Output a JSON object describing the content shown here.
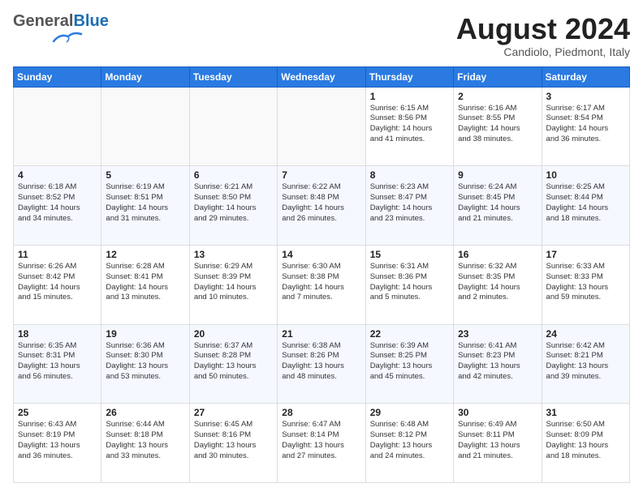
{
  "header": {
    "logo_general": "General",
    "logo_blue": "Blue",
    "month_title": "August 2024",
    "subtitle": "Candiolo, Piedmont, Italy"
  },
  "days_of_week": [
    "Sunday",
    "Monday",
    "Tuesday",
    "Wednesday",
    "Thursday",
    "Friday",
    "Saturday"
  ],
  "weeks": [
    [
      {
        "day": "",
        "info": ""
      },
      {
        "day": "",
        "info": ""
      },
      {
        "day": "",
        "info": ""
      },
      {
        "day": "",
        "info": ""
      },
      {
        "day": "1",
        "info": "Sunrise: 6:15 AM\nSunset: 8:56 PM\nDaylight: 14 hours\nand 41 minutes."
      },
      {
        "day": "2",
        "info": "Sunrise: 6:16 AM\nSunset: 8:55 PM\nDaylight: 14 hours\nand 38 minutes."
      },
      {
        "day": "3",
        "info": "Sunrise: 6:17 AM\nSunset: 8:54 PM\nDaylight: 14 hours\nand 36 minutes."
      }
    ],
    [
      {
        "day": "4",
        "info": "Sunrise: 6:18 AM\nSunset: 8:52 PM\nDaylight: 14 hours\nand 34 minutes."
      },
      {
        "day": "5",
        "info": "Sunrise: 6:19 AM\nSunset: 8:51 PM\nDaylight: 14 hours\nand 31 minutes."
      },
      {
        "day": "6",
        "info": "Sunrise: 6:21 AM\nSunset: 8:50 PM\nDaylight: 14 hours\nand 29 minutes."
      },
      {
        "day": "7",
        "info": "Sunrise: 6:22 AM\nSunset: 8:48 PM\nDaylight: 14 hours\nand 26 minutes."
      },
      {
        "day": "8",
        "info": "Sunrise: 6:23 AM\nSunset: 8:47 PM\nDaylight: 14 hours\nand 23 minutes."
      },
      {
        "day": "9",
        "info": "Sunrise: 6:24 AM\nSunset: 8:45 PM\nDaylight: 14 hours\nand 21 minutes."
      },
      {
        "day": "10",
        "info": "Sunrise: 6:25 AM\nSunset: 8:44 PM\nDaylight: 14 hours\nand 18 minutes."
      }
    ],
    [
      {
        "day": "11",
        "info": "Sunrise: 6:26 AM\nSunset: 8:42 PM\nDaylight: 14 hours\nand 15 minutes."
      },
      {
        "day": "12",
        "info": "Sunrise: 6:28 AM\nSunset: 8:41 PM\nDaylight: 14 hours\nand 13 minutes."
      },
      {
        "day": "13",
        "info": "Sunrise: 6:29 AM\nSunset: 8:39 PM\nDaylight: 14 hours\nand 10 minutes."
      },
      {
        "day": "14",
        "info": "Sunrise: 6:30 AM\nSunset: 8:38 PM\nDaylight: 14 hours\nand 7 minutes."
      },
      {
        "day": "15",
        "info": "Sunrise: 6:31 AM\nSunset: 8:36 PM\nDaylight: 14 hours\nand 5 minutes."
      },
      {
        "day": "16",
        "info": "Sunrise: 6:32 AM\nSunset: 8:35 PM\nDaylight: 14 hours\nand 2 minutes."
      },
      {
        "day": "17",
        "info": "Sunrise: 6:33 AM\nSunset: 8:33 PM\nDaylight: 13 hours\nand 59 minutes."
      }
    ],
    [
      {
        "day": "18",
        "info": "Sunrise: 6:35 AM\nSunset: 8:31 PM\nDaylight: 13 hours\nand 56 minutes."
      },
      {
        "day": "19",
        "info": "Sunrise: 6:36 AM\nSunset: 8:30 PM\nDaylight: 13 hours\nand 53 minutes."
      },
      {
        "day": "20",
        "info": "Sunrise: 6:37 AM\nSunset: 8:28 PM\nDaylight: 13 hours\nand 50 minutes."
      },
      {
        "day": "21",
        "info": "Sunrise: 6:38 AM\nSunset: 8:26 PM\nDaylight: 13 hours\nand 48 minutes."
      },
      {
        "day": "22",
        "info": "Sunrise: 6:39 AM\nSunset: 8:25 PM\nDaylight: 13 hours\nand 45 minutes."
      },
      {
        "day": "23",
        "info": "Sunrise: 6:41 AM\nSunset: 8:23 PM\nDaylight: 13 hours\nand 42 minutes."
      },
      {
        "day": "24",
        "info": "Sunrise: 6:42 AM\nSunset: 8:21 PM\nDaylight: 13 hours\nand 39 minutes."
      }
    ],
    [
      {
        "day": "25",
        "info": "Sunrise: 6:43 AM\nSunset: 8:19 PM\nDaylight: 13 hours\nand 36 minutes."
      },
      {
        "day": "26",
        "info": "Sunrise: 6:44 AM\nSunset: 8:18 PM\nDaylight: 13 hours\nand 33 minutes."
      },
      {
        "day": "27",
        "info": "Sunrise: 6:45 AM\nSunset: 8:16 PM\nDaylight: 13 hours\nand 30 minutes."
      },
      {
        "day": "28",
        "info": "Sunrise: 6:47 AM\nSunset: 8:14 PM\nDaylight: 13 hours\nand 27 minutes."
      },
      {
        "day": "29",
        "info": "Sunrise: 6:48 AM\nSunset: 8:12 PM\nDaylight: 13 hours\nand 24 minutes."
      },
      {
        "day": "30",
        "info": "Sunrise: 6:49 AM\nSunset: 8:11 PM\nDaylight: 13 hours\nand 21 minutes."
      },
      {
        "day": "31",
        "info": "Sunrise: 6:50 AM\nSunset: 8:09 PM\nDaylight: 13 hours\nand 18 minutes."
      }
    ]
  ]
}
